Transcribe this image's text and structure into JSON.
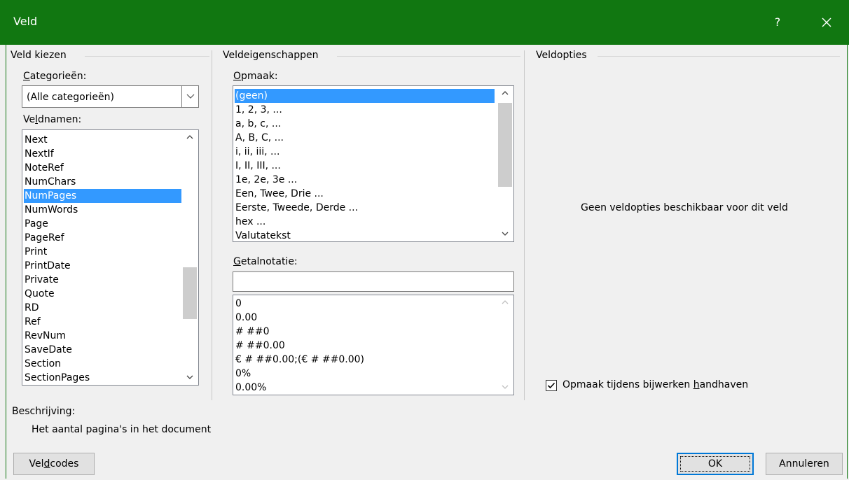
{
  "window": {
    "title": "Veld",
    "help_label": "?",
    "title_bar_color": "#117711",
    "close_icon": "close-icon"
  },
  "choose_field": {
    "group_label": "Veld kiezen",
    "categories_label": "Categorieën:",
    "categories_mnemonic": "C",
    "categories_rest": "ategorieën:",
    "categories_value": "(Alle categorieën)",
    "field_names_label": "Veldnamen:",
    "field_names_pre": "Ve",
    "field_names_mnemonic": "l",
    "field_names_rest": "dnamen:",
    "field_names": [
      "Next",
      "NextIf",
      "NoteRef",
      "NumChars",
      "NumPages",
      "NumWords",
      "Page",
      "PageRef",
      "Print",
      "PrintDate",
      "Private",
      "Quote",
      "RD",
      "Ref",
      "RevNum",
      "SaveDate",
      "Section",
      "SectionPages"
    ],
    "selected_field": "NumPages"
  },
  "field_properties": {
    "group_label": "Veldeigenschappen",
    "format_label": "Opmaak:",
    "format_mnemonic": "O",
    "format_rest": "pmaak:",
    "formats": [
      "(geen)",
      "1, 2, 3, ...",
      "a, b, c, ...",
      "A, B, C, ...",
      "i, ii, iii, ...",
      "I, II, III, ...",
      "1e, 2e, 3e ...",
      "Een, Twee, Drie ...",
      "Eerste, Tweede, Derde ...",
      "hex ...",
      "Valutatekst"
    ],
    "selected_format": "(geen)",
    "number_format_label": "Getalnotatie:",
    "number_format_mnemonic": "G",
    "number_format_rest": "etalnotatie:",
    "number_format_value": "",
    "number_formats": [
      "0",
      "0.00",
      "# ##0",
      "# ##0.00",
      "€ # ##0.00;(€ # ##0.00)",
      "0%",
      "0.00%"
    ]
  },
  "field_options": {
    "group_label": "Veldopties",
    "empty_message": "Geen veldopties beschikbaar voor dit veld",
    "preserve_label_pre": "Opmaak tijdens bijwerken ",
    "preserve_mnemonic": "h",
    "preserve_label_rest": "andhaven",
    "preserve_checked": true
  },
  "description": {
    "label": "Beschrijving:",
    "text": "Het aantal pagina's in het document"
  },
  "buttons": {
    "field_codes_pre": "Vel",
    "field_codes_mnemonic": "d",
    "field_codes_rest": "codes",
    "ok": "OK",
    "cancel": "Annuleren"
  },
  "colors": {
    "selection": "#3399ff",
    "default_button_border": "#0078d7"
  }
}
